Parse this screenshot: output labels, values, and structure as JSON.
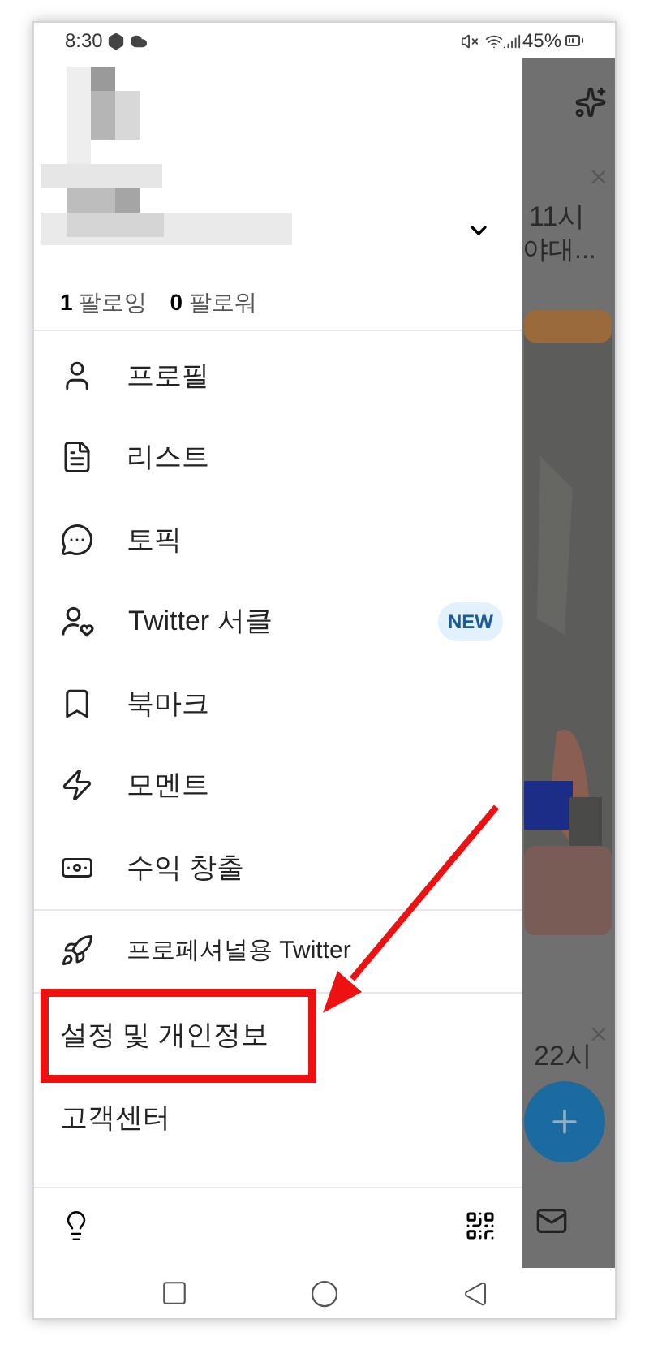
{
  "status_bar": {
    "time": "8:30",
    "battery": "45%"
  },
  "drawer": {
    "follow_counts": [
      {
        "count": "1",
        "label": "팔로잉"
      },
      {
        "count": "0",
        "label": "팔로워"
      }
    ],
    "menu_items": [
      {
        "kind": "icon",
        "label": "프로필"
      },
      {
        "kind": "icon",
        "label": "리스트"
      },
      {
        "kind": "icon",
        "label": "토픽"
      },
      {
        "kind": "icon",
        "label": "Twitter 서클",
        "badge": "NEW"
      },
      {
        "kind": "icon",
        "label": "북마크"
      },
      {
        "kind": "icon",
        "label": "모멘트"
      },
      {
        "kind": "icon",
        "label": "수익 창출"
      },
      {
        "kind": "icon",
        "label": "프로페셔널용 Twitter"
      }
    ],
    "secondary_items": [
      {
        "label": "설정 및 개인정보",
        "highlighted": true
      },
      {
        "label": "고객센터",
        "highlighted": false
      }
    ]
  },
  "background_feed": {
    "texts": [
      "11시",
      "야대...",
      "22시"
    ]
  }
}
